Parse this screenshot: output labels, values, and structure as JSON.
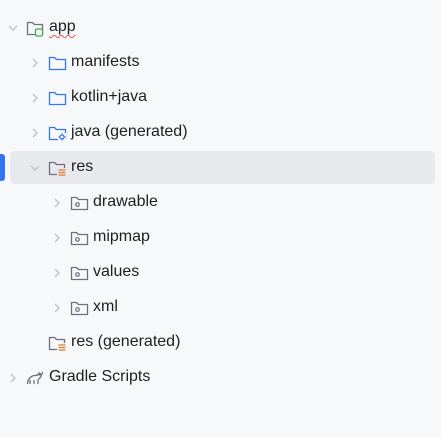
{
  "project_tree": {
    "root": {
      "label": "app"
    },
    "manifests": {
      "label": "manifests"
    },
    "kotlin_java": {
      "label": "kotlin+java"
    },
    "java_generated": {
      "label": "java (generated)"
    },
    "res": {
      "label": "res"
    },
    "drawable": {
      "label": "drawable"
    },
    "mipmap": {
      "label": "mipmap"
    },
    "values": {
      "label": "values"
    },
    "xml": {
      "label": "xml"
    },
    "res_generated": {
      "label": "res (generated)"
    },
    "gradle_scripts": {
      "label": "Gradle Scripts"
    }
  },
  "icons": {
    "module": "module-folder-icon",
    "folder": "folder-icon",
    "generated_folder": "generated-source-folder-icon",
    "resource_folder": "resource-folder-icon",
    "resource_subfolder": "resource-subfolder-icon",
    "gradle": "gradle-elephant-icon",
    "expand": "chevron-right-icon",
    "collapse": "chevron-down-icon"
  },
  "colors": {
    "selection_background": "#e8e9ec",
    "focus_indicator": "#3574f0",
    "folder_blue": "#3574f0",
    "resource_orange": "#e07b29",
    "module_green": "#3aa858",
    "spellcheck_underline": "#e55757"
  }
}
